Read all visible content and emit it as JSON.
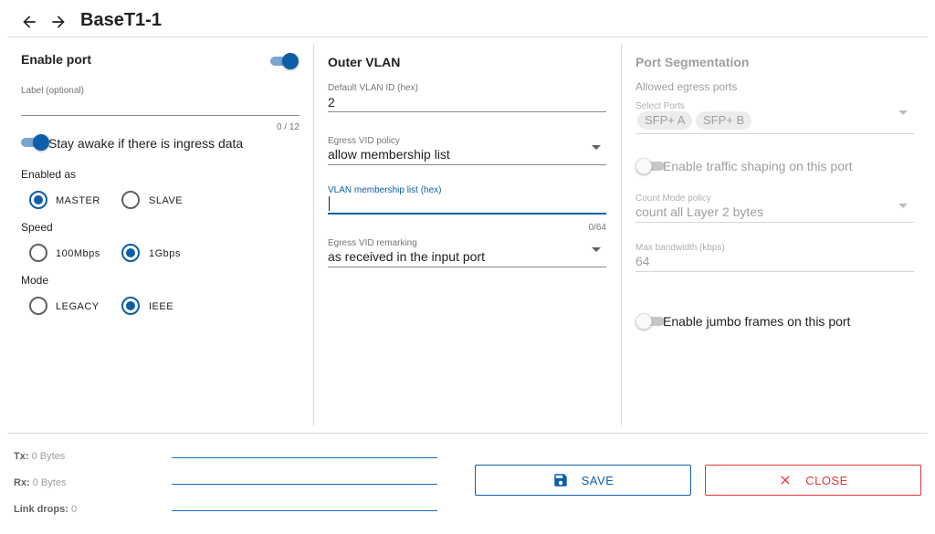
{
  "header": {
    "title": "BaseT1-1",
    "back_icon": "arrow-left-icon",
    "forward_icon": "arrow-right-icon"
  },
  "left": {
    "enable_port_label": "Enable port",
    "enable_port_on": true,
    "label_field": {
      "label": "Label (optional)",
      "value": "",
      "counter": "0 / 12"
    },
    "stay_awake_label": "Stay awake if there is ingress data",
    "stay_awake_on": true,
    "enabled_as": {
      "label": "Enabled as",
      "options": [
        "MASTER",
        "SLAVE"
      ],
      "selected": "MASTER"
    },
    "speed": {
      "label": "Speed",
      "options": [
        "100Mbps",
        "1Gbps"
      ],
      "selected": "1Gbps"
    },
    "mode": {
      "label": "Mode",
      "options": [
        "LEGACY",
        "IEEE"
      ],
      "selected": "IEEE"
    }
  },
  "middle": {
    "title": "Outer VLAN",
    "default_vlan": {
      "label": "Default VLAN ID (hex)",
      "value": "2"
    },
    "egress_policy": {
      "label": "Egress VID policy",
      "value": "allow membership list"
    },
    "membership": {
      "label": "VLAN membership list (hex)",
      "value": "",
      "counter": "0/64"
    },
    "egress_remark": {
      "label": "Egress VID remarking",
      "value": "as received in the input port"
    }
  },
  "right": {
    "title": "Port Segmentation",
    "allowed_egress_label": "Allowed egress ports",
    "select_ports_label": "Select Ports",
    "ports": [
      "SFP+ A",
      "SFP+ B"
    ],
    "traffic_shaping_label": "Enable traffic shaping on this port",
    "traffic_shaping_on": false,
    "count_mode": {
      "label": "Count Mode policy",
      "value": "count all Layer 2 bytes"
    },
    "max_bandwidth": {
      "label": "Max bandwidth (kbps)",
      "value": "64"
    },
    "jumbo_label": "Enable jumbo frames on this port",
    "jumbo_on": false
  },
  "footer": {
    "tx": {
      "label": "Tx:",
      "value": "0 Bytes"
    },
    "rx": {
      "label": "Rx:",
      "value": "0 Bytes"
    },
    "link_drops": {
      "label": "Link drops:",
      "value": "0"
    },
    "save_label": "SAVE",
    "close_label": "CLOSE"
  },
  "colors": {
    "accent": "#0d5ea8",
    "danger": "#e53935"
  }
}
